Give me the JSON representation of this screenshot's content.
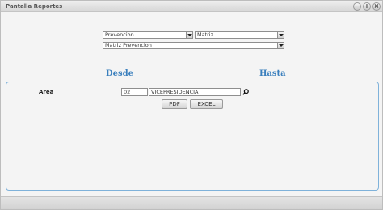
{
  "window": {
    "title": "Pantalla Reportes",
    "minimize_glyph": "−",
    "maximize_glyph": "+",
    "close_glyph": "×"
  },
  "filters": {
    "selects": [
      {
        "value": "Prevencion"
      },
      {
        "value": "Matriz"
      },
      {
        "value": "Matriz Prevencion"
      }
    ]
  },
  "range": {
    "from_label": "Desde",
    "to_label": "Hasta"
  },
  "form": {
    "area_label": "Area",
    "area_code": "02",
    "area_name": "VICEPRESIDENCIA"
  },
  "actions": {
    "pdf_label": "PDF",
    "excel_label": "EXCEL"
  },
  "colors": {
    "heading": "#3a7fbd",
    "panel_border": "#7fb2da"
  },
  "icons": {
    "search": "magnifier-icon"
  }
}
